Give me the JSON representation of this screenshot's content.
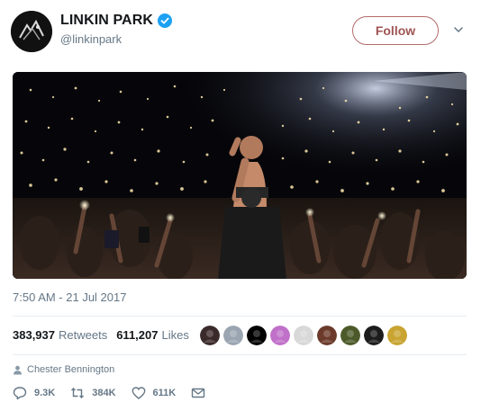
{
  "account": {
    "display_name": "LINKIN PARK",
    "handle": "@linkinpark",
    "verified": true,
    "avatar_icon": "band-logo-avatar"
  },
  "header": {
    "follow_label": "Follow",
    "menu_icon": "chevron-down-icon",
    "follow_color": "#a05454"
  },
  "tweet": {
    "media_alt": "concert-crowd-photo",
    "timestamp": "7:50 AM - 21 Jul 2017"
  },
  "stats": {
    "retweets_count": "383,937",
    "retweets_label": "Retweets",
    "likes_count": "611,207",
    "likes_label": "Likes"
  },
  "likers": [
    {
      "color": "#3b2a2a"
    },
    {
      "color": "#9aa5b1"
    },
    {
      "color": "#000000"
    },
    {
      "color": "#c070c8"
    },
    {
      "color": "#d8d8d8"
    },
    {
      "color": "#6b3a2a"
    },
    {
      "color": "#4c5a2a"
    },
    {
      "color": "#1c1c1c"
    },
    {
      "color": "#c9a431"
    }
  ],
  "mention": {
    "icon": "person-icon",
    "name": "Chester Bennington"
  },
  "actions": {
    "reply_count": "9.3K",
    "retweet_count": "384K",
    "like_count": "611K",
    "reply_icon": "reply-icon",
    "retweet_icon": "retweet-icon",
    "like_icon": "heart-icon",
    "dm_icon": "envelope-icon"
  }
}
